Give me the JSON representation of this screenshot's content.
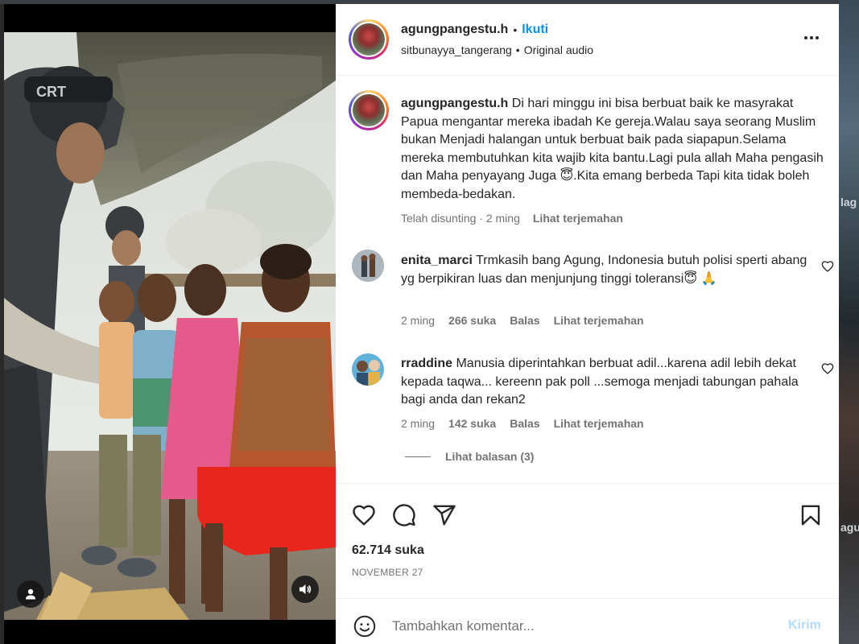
{
  "post": {
    "author": "agungpangestu.h",
    "separator": "•",
    "follow_label": "Ikuti",
    "audio_account": "sitbunayya_tangerang",
    "audio_label": "Original audio",
    "caption_user": "agungpangestu.h",
    "caption": "Di hari minggu ini bisa berbuat baik ke masyrakat Papua mengantar mereka ibadah Ke gereja.Walau saya seorang Muslim bukan Menjadi halangan untuk berbuat baik pada siapapun.Selama mereka membutuhkan kita wajib kita bantu.Lagi pula allah Maha pengasih dan Maha penyayang Juga 😇.Kita emang berbeda Tapi kita tidak boleh membeda-bedakan.",
    "caption_meta": {
      "edited": "Telah disunting · 2 ming",
      "translate": "Lihat terjemahan"
    },
    "likes": "62.714 suka",
    "date": "NOVEMBER 27"
  },
  "comments": [
    {
      "username": "enita_marci",
      "text": "Trmkasih bang Agung, Indonesia butuh polisi sperti abang yg berpikiran luas dan menjunjung tinggi toleransi😇 🙏",
      "age": "2 ming",
      "likes": "266 suka",
      "reply": "Balas",
      "translate": "Lihat terjemahan"
    },
    {
      "username": "rraddine",
      "text": "Manusia diperintahkan berbuat adil...karena adil lebih dekat kepada taqwa... kereenn pak poll ...semoga menjadi tabungan pahala bagi anda dan rekan2",
      "age": "2 ming",
      "likes": "142 suka",
      "reply": "Balas",
      "translate": "Lihat terjemahan",
      "view_replies": "Lihat balasan (3)"
    }
  ],
  "composer": {
    "placeholder": "Tambahkan komentar...",
    "send_label": "Kirim"
  },
  "background_peek": {
    "top": "lag",
    "bottom": "agu"
  },
  "icons": [
    "heart-icon",
    "comment-icon",
    "share-icon",
    "bookmark-icon",
    "more-icon",
    "emoji-icon",
    "user-tag-icon",
    "sound-icon"
  ],
  "colors": {
    "follow": "#0095f6",
    "send_disabled": "#b3dbff",
    "muted": "#737373",
    "text": "#262626"
  }
}
